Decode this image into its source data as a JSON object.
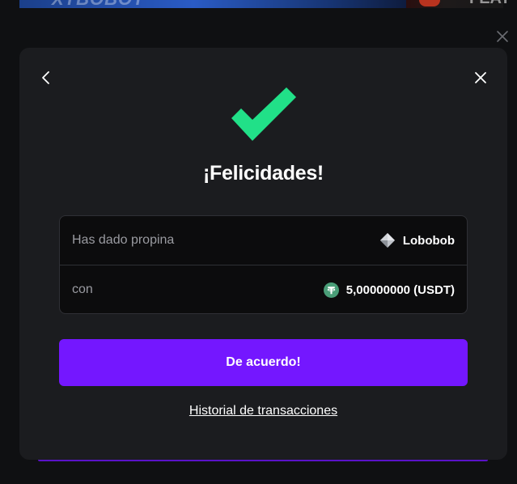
{
  "background": {
    "banner_left_text": "XTBOBOT",
    "banner_right_text": "FEAT"
  },
  "modal": {
    "title": "¡Felicidades!",
    "rows": [
      {
        "label": "Has dado propina",
        "value": "Lobobob",
        "icon": "diamond-icon"
      },
      {
        "label": "con",
        "value": "5,00000000 (USDT)",
        "icon": "usdt-icon"
      }
    ],
    "primary_button": "De acuerdo!",
    "history_link": "Historial de transacciones"
  },
  "colors": {
    "accent": "#7417ff",
    "success": "#21e088",
    "modal_bg": "#1b1c1f",
    "page_bg": "#0f1012",
    "usdt": "#4a9e78"
  }
}
